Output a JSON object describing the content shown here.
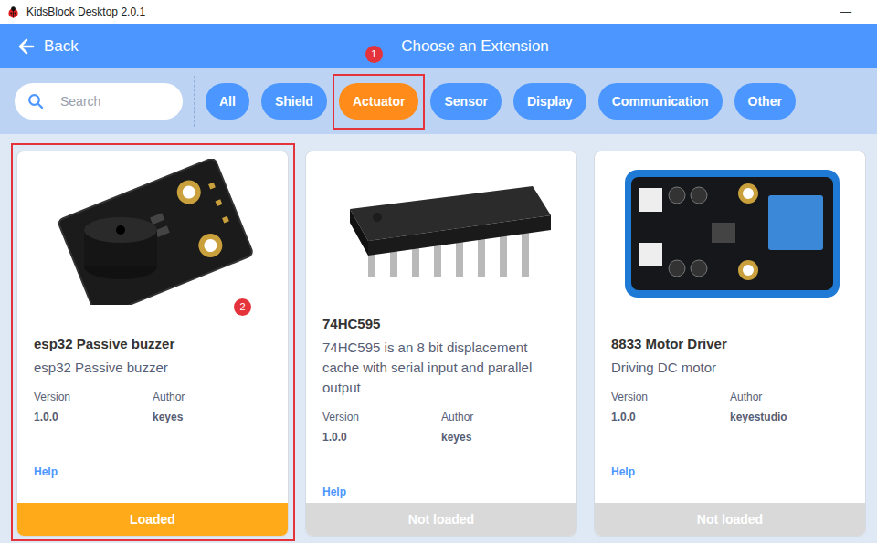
{
  "window": {
    "title": "KidsBlock Desktop 2.0.1",
    "minimize": "—"
  },
  "header": {
    "back": "Back",
    "title": "Choose an Extension"
  },
  "search": {
    "placeholder": "Search"
  },
  "filters": [
    {
      "label": "All",
      "selected": false
    },
    {
      "label": "Shield",
      "selected": false
    },
    {
      "label": "Actuator",
      "selected": true,
      "annotation": "1"
    },
    {
      "label": "Sensor",
      "selected": false
    },
    {
      "label": "Display",
      "selected": false
    },
    {
      "label": "Communication",
      "selected": false
    },
    {
      "label": "Other",
      "selected": false
    }
  ],
  "extensions": [
    {
      "kind": "buzzer",
      "name": "esp32 Passive buzzer",
      "description": "esp32 Passive buzzer",
      "version_label": "Version",
      "version": "1.0.0",
      "author_label": "Author",
      "author": "keyes",
      "help": "Help",
      "status": "Loaded",
      "loaded": true,
      "annotation": "2"
    },
    {
      "kind": "chip",
      "name": "74HC595",
      "description": "74HC595 is an 8 bit displacement cache with serial input and parallel output",
      "version_label": "Version",
      "version": "1.0.0",
      "author_label": "Author",
      "author": "keyes",
      "help": "Help",
      "status": "Not loaded",
      "loaded": false
    },
    {
      "kind": "motor-driver",
      "name": "8833 Motor Driver",
      "description": "Driving DC motor",
      "version_label": "Version",
      "version": "1.0.0",
      "author_label": "Author",
      "author": "keyestudio",
      "help": "Help",
      "status": "Not loaded",
      "loaded": false
    }
  ]
}
